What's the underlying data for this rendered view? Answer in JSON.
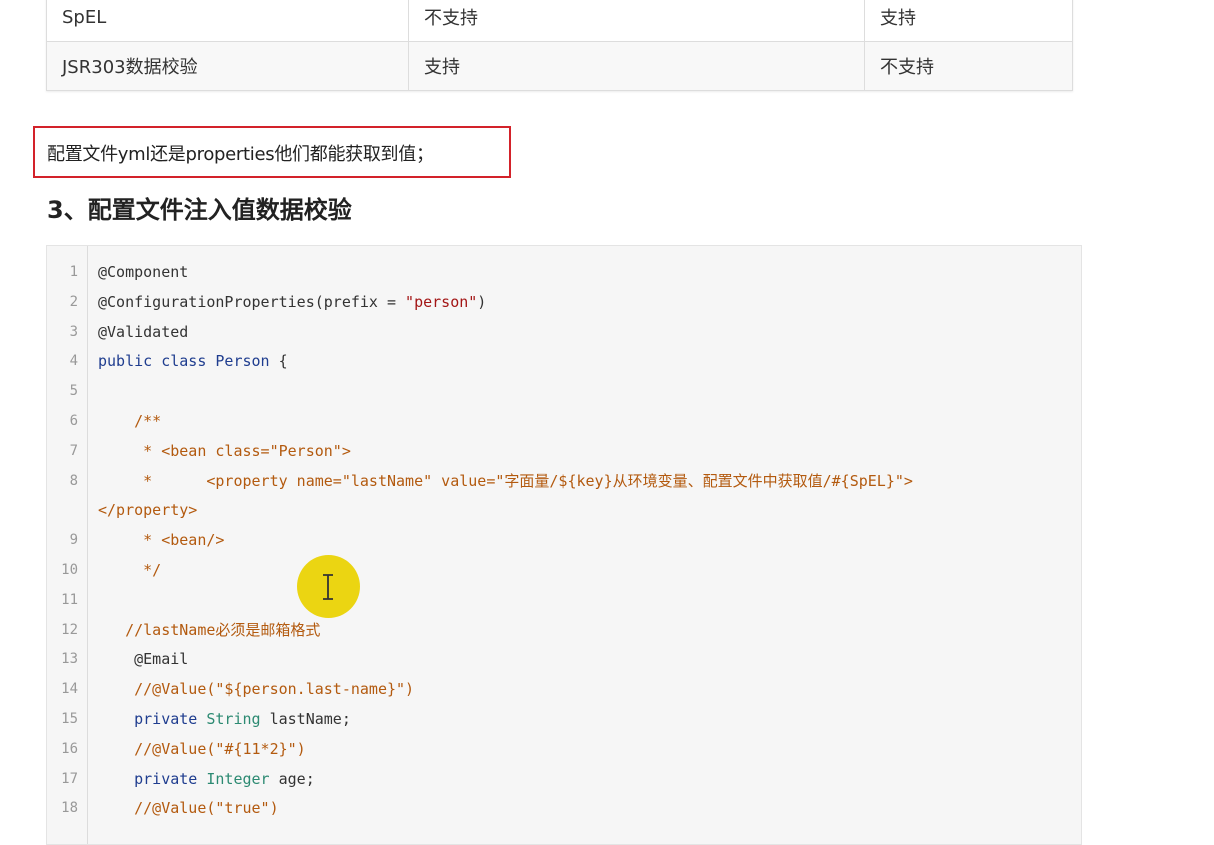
{
  "table": {
    "rows": [
      [
        "SpEL",
        "不支持",
        "支持"
      ],
      [
        "JSR303数据校验",
        "支持",
        "不支持"
      ]
    ]
  },
  "note": "配置文件yml还是properties他们都能获取到值；",
  "section_title": "3、配置文件注入值数据校验",
  "code": {
    "lines": [
      {
        "n": "1",
        "parts": [
          [
            "@Component",
            "plain"
          ]
        ]
      },
      {
        "n": "2",
        "parts": [
          [
            "@ConfigurationProperties(prefix = ",
            "plain"
          ],
          [
            "\"person\"",
            "string"
          ],
          [
            ")",
            "plain"
          ]
        ]
      },
      {
        "n": "3",
        "parts": [
          [
            "@Validated",
            "plain"
          ]
        ]
      },
      {
        "n": "4",
        "parts": [
          [
            "public class ",
            "keyword"
          ],
          [
            "Person",
            "keyword"
          ],
          [
            " {",
            "plain"
          ]
        ]
      },
      {
        "n": "5",
        "parts": []
      },
      {
        "n": "6",
        "parts": [
          [
            "    /**",
            "comment"
          ]
        ]
      },
      {
        "n": "7",
        "parts": [
          [
            "     * <bean class=\"Person\">",
            "comment"
          ]
        ]
      },
      {
        "n": "8",
        "parts": [
          [
            "     *      <property name=\"lastName\" value=\"字面量/${key}从环境变量、配置文件中获取值/#{SpEL}\">",
            "comment"
          ]
        ],
        "cont": "</property>"
      },
      {
        "n": "9",
        "parts": [
          [
            "     * <bean/>",
            "comment"
          ]
        ]
      },
      {
        "n": "10",
        "parts": [
          [
            "     */",
            "comment"
          ]
        ]
      },
      {
        "n": "11",
        "parts": []
      },
      {
        "n": "12",
        "parts": [
          [
            "   //lastName必须是邮箱格式",
            "comment"
          ]
        ]
      },
      {
        "n": "13",
        "parts": [
          [
            "    @Email",
            "plain"
          ]
        ]
      },
      {
        "n": "14",
        "parts": [
          [
            "    //@Value(\"${person.last-name}\")",
            "comment"
          ]
        ]
      },
      {
        "n": "15",
        "parts": [
          [
            "    private ",
            "keyword"
          ],
          [
            "String",
            "type"
          ],
          [
            " lastName;",
            "plain"
          ]
        ]
      },
      {
        "n": "16",
        "parts": [
          [
            "    //@Value(\"#{11*2}\")",
            "comment"
          ]
        ]
      },
      {
        "n": "17",
        "parts": [
          [
            "    private ",
            "keyword"
          ],
          [
            "Integer",
            "type"
          ],
          [
            " age;",
            "plain"
          ]
        ]
      },
      {
        "n": "18",
        "parts": [
          [
            "    //@Value(\"true\")",
            "comment"
          ]
        ]
      }
    ]
  },
  "colors": {
    "note_border": "#d3222a",
    "cursor_highlight": "#e9d200",
    "keyword": "#1f3d8f",
    "type": "#2c8a72",
    "string": "#a31515",
    "comment": "#b35a0f"
  },
  "icons": {
    "cursor": "text-cursor-icon"
  }
}
